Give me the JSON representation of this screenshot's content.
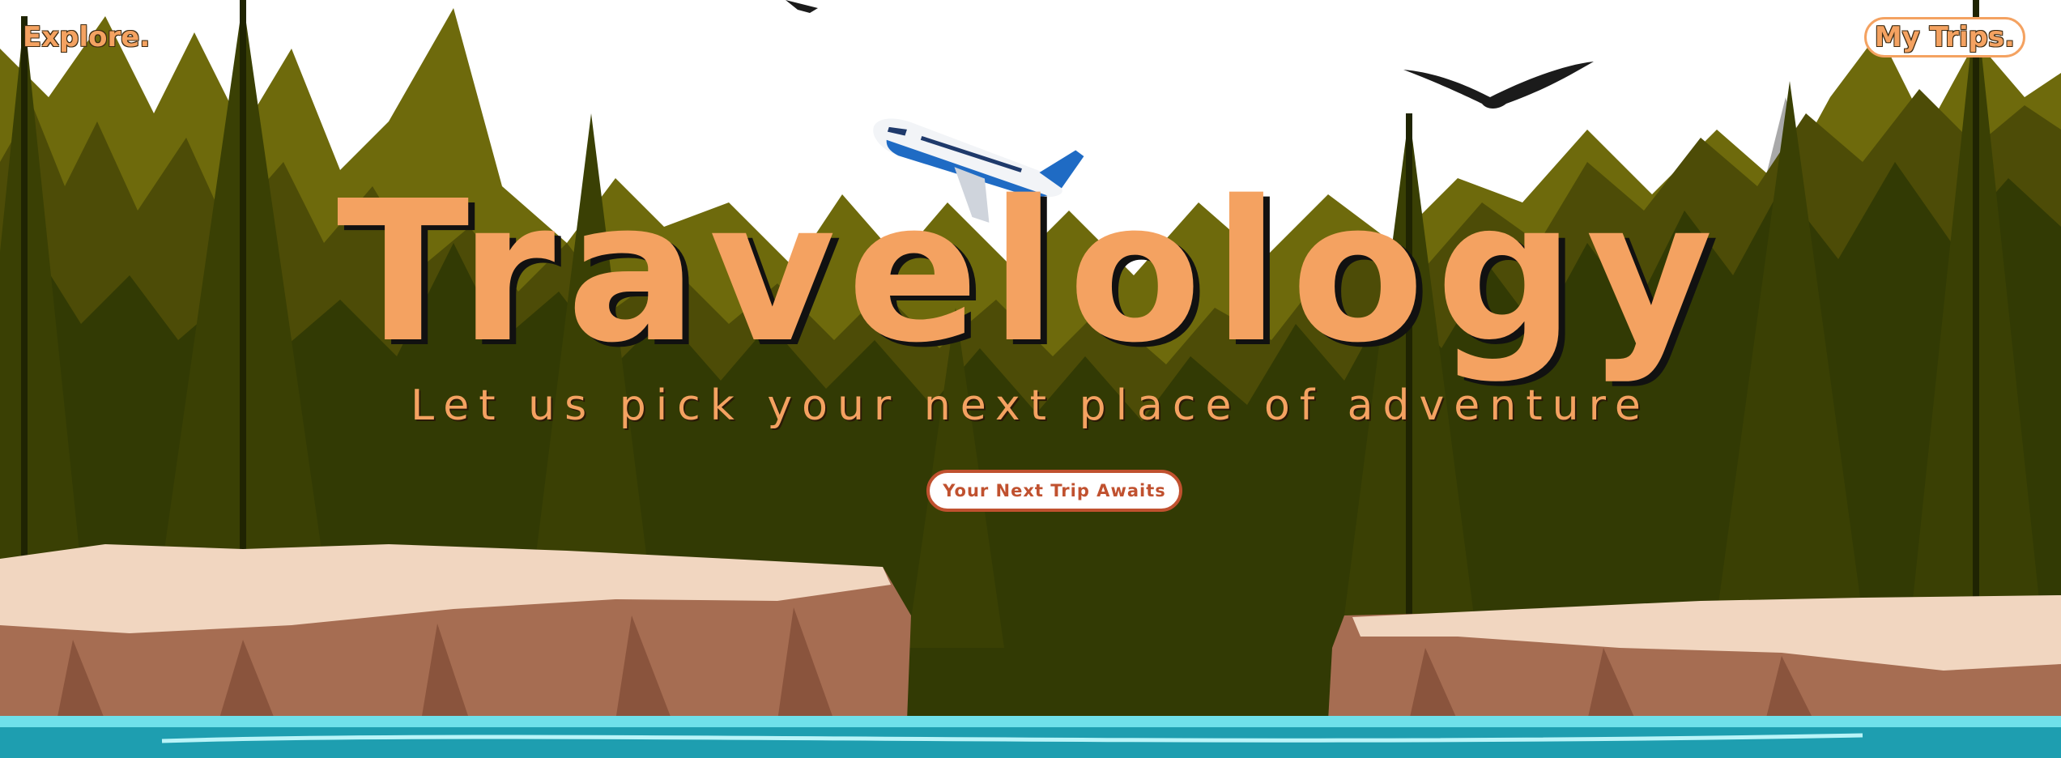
{
  "nav": {
    "brand": "Explore.",
    "my_trips_label": "My Trips."
  },
  "hero": {
    "title": "Travelology",
    "subtitle": "Let us pick your next place of adventure",
    "cta_label": "Your Next Trip Awaits"
  },
  "colors": {
    "accent": "#f4a261",
    "cta_border": "#c0512f",
    "forest_back": "#6b6b0b",
    "forest_front": "#2e3603",
    "cliff_top": "#f0d4bd",
    "cliff_face": "#a66d52",
    "water": "#2ec4d3",
    "sky": "#ffffff"
  },
  "icons": {
    "airplane": "airplane-icon",
    "bird": "eagle-icon"
  }
}
